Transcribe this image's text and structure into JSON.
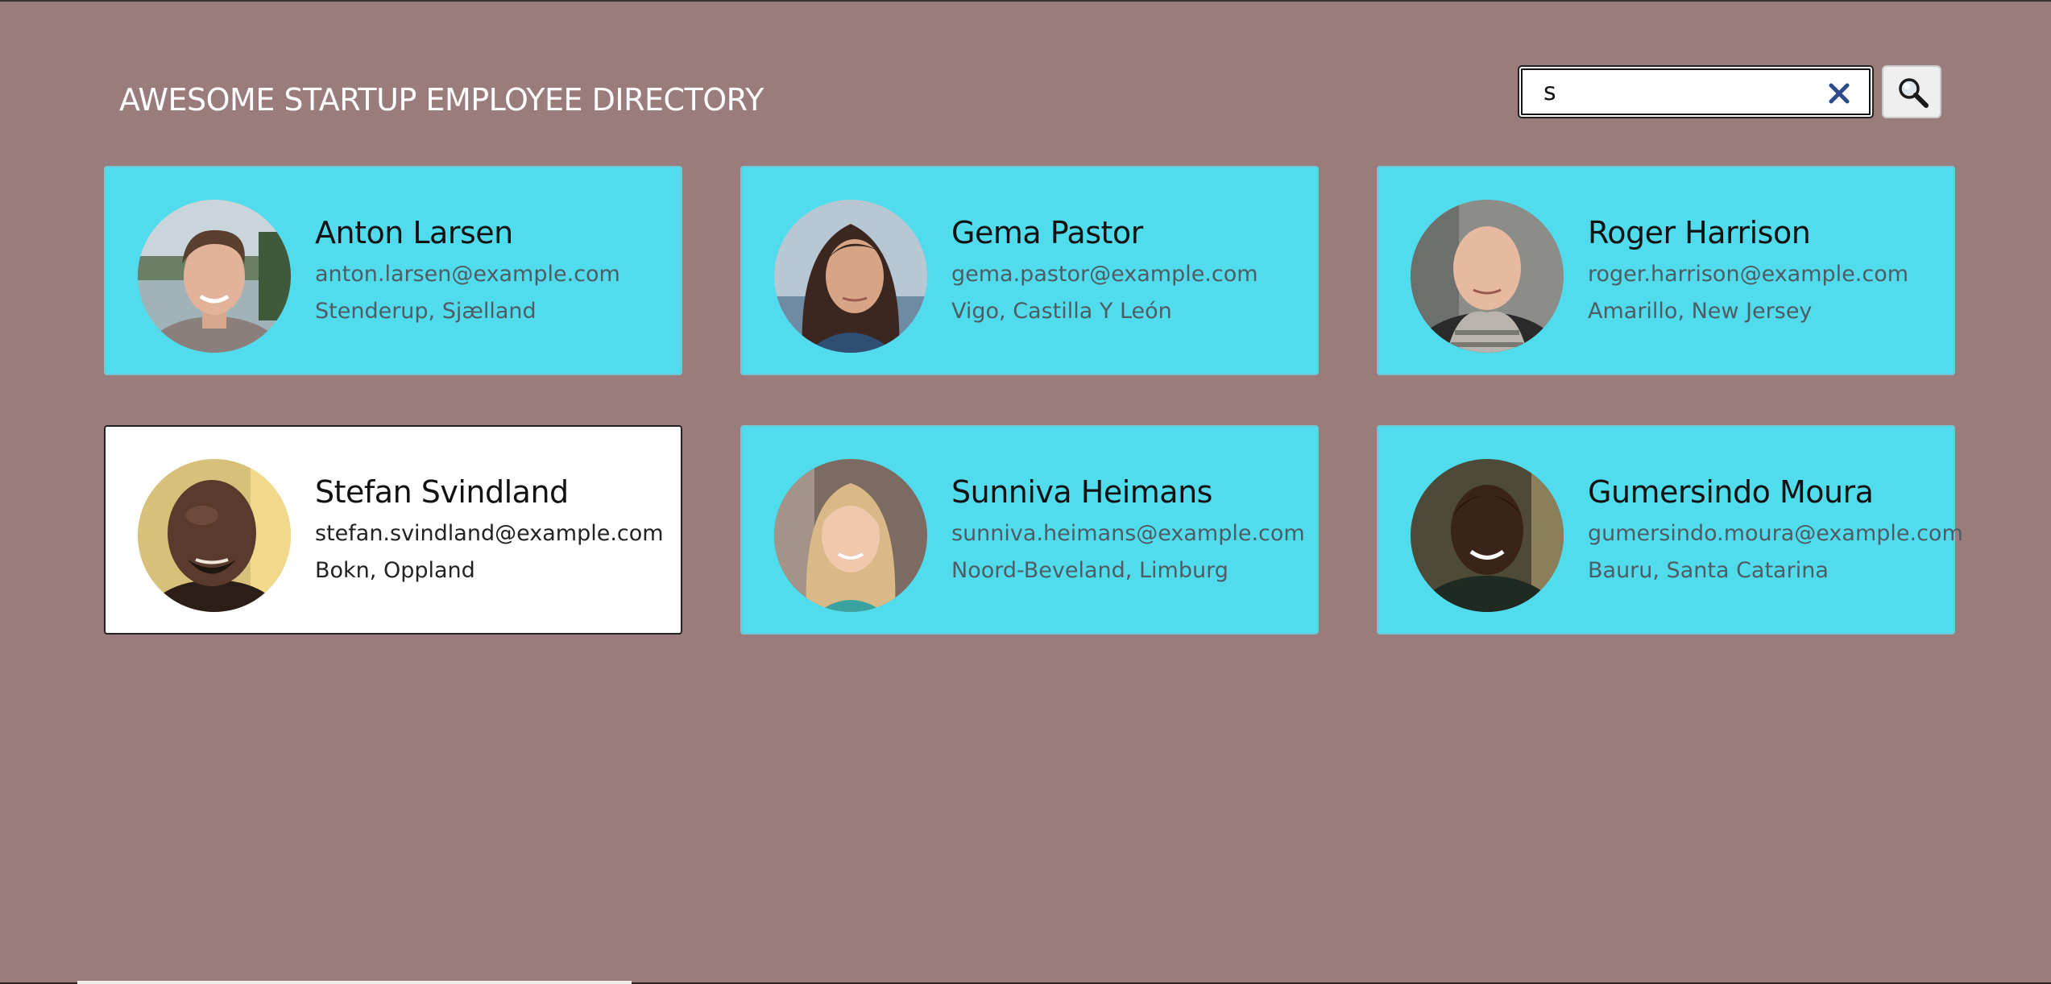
{
  "header": {
    "title": "AWESOME STARTUP EMPLOYEE DIRECTORY"
  },
  "search": {
    "value": "s",
    "placeholder": "",
    "clear_icon": "close-icon",
    "submit_icon": "search-icon"
  },
  "colors": {
    "background": "#9b7c7c",
    "card": "#51dced",
    "card_selected": "#ffffff",
    "text_muted": "#4f5c63"
  },
  "employees": [
    {
      "name": "Anton Larsen",
      "email": "anton.larsen@example.com",
      "location": "Stenderup, Sjælland",
      "selected": false
    },
    {
      "name": "Gema Pastor",
      "email": "gema.pastor@example.com",
      "location": "Vigo, Castilla Y León",
      "selected": false
    },
    {
      "name": "Roger Harrison",
      "email": "roger.harrison@example.com",
      "location": "Amarillo, New Jersey",
      "selected": false
    },
    {
      "name": "Stefan Svindland",
      "email": "stefan.svindland@example.com",
      "location": "Bokn, Oppland",
      "selected": true
    },
    {
      "name": "Sunniva Heimans",
      "email": "sunniva.heimans@example.com",
      "location": "Noord-Beveland, Limburg",
      "selected": false
    },
    {
      "name": "Gumersindo Moura",
      "email": "gumersindo.moura@example.com",
      "location": "Bauru, Santa Catarina",
      "selected": false
    }
  ]
}
